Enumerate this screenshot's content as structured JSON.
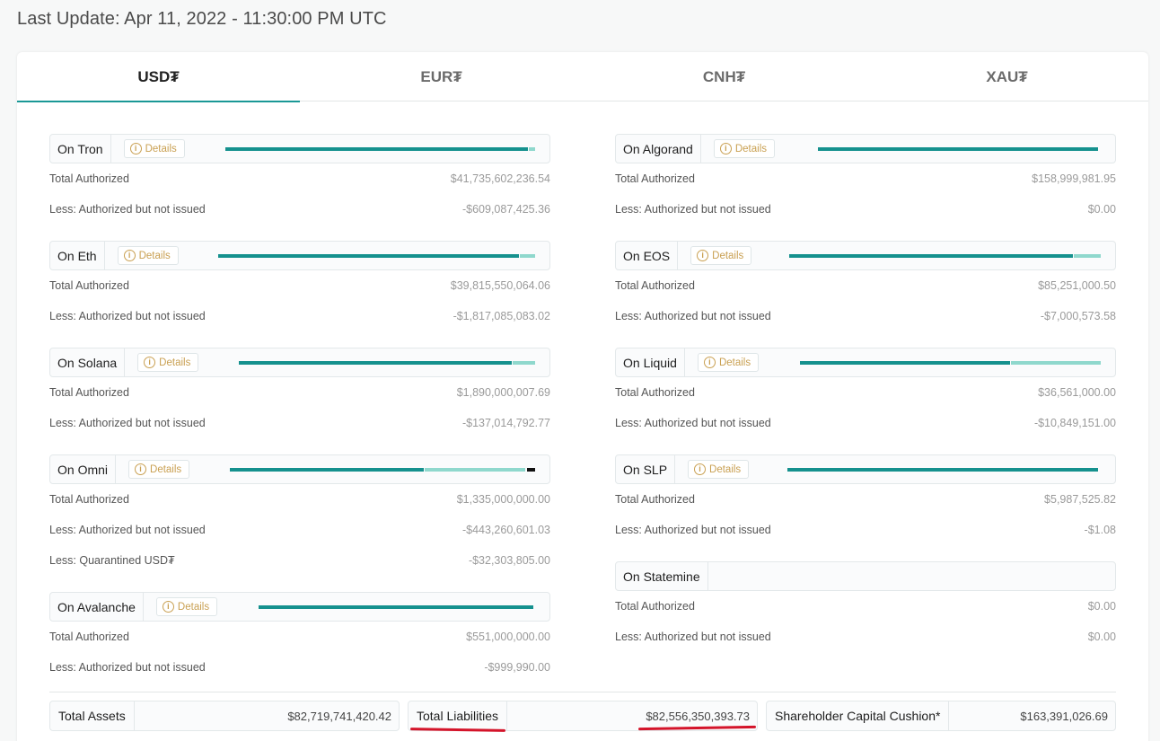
{
  "last_update": "Last Update: Apr 11, 2022 - 11:30:00 PM UTC",
  "tabs": [
    "USD₮",
    "EUR₮",
    "CNH₮",
    "XAU₮"
  ],
  "active_tab": "USD₮",
  "details_label": "Details",
  "accent_color": "#1a9896",
  "left_chains": [
    {
      "name": "On Tron",
      "rows": [
        {
          "label": "Total Authorized",
          "value": "$41,735,602,236.54"
        },
        {
          "label": "Less: Authorized but not issued",
          "value": "-$609,087,425.36"
        }
      ]
    },
    {
      "name": "On Eth",
      "rows": [
        {
          "label": "Total Authorized",
          "value": "$39,815,550,064.06"
        },
        {
          "label": "Less: Authorized but not issued",
          "value": "-$1,817,085,083.02"
        }
      ]
    },
    {
      "name": "On Solana",
      "rows": [
        {
          "label": "Total Authorized",
          "value": "$1,890,000,007.69"
        },
        {
          "label": "Less: Authorized but not issued",
          "value": "-$137,014,792.77"
        }
      ]
    },
    {
      "name": "On Omni",
      "rows": [
        {
          "label": "Total Authorized",
          "value": "$1,335,000,000.00"
        },
        {
          "label": "Less: Authorized but not issued",
          "value": "-$443,260,601.03"
        },
        {
          "label": "Less: Quarantined USD₮",
          "value": "-$32,303,805.00"
        }
      ]
    },
    {
      "name": "On Avalanche",
      "rows": [
        {
          "label": "Total Authorized",
          "value": "$551,000,000.00"
        },
        {
          "label": "Less: Authorized but not issued",
          "value": "-$999,990.00"
        }
      ]
    }
  ],
  "right_chains": [
    {
      "name": "On Algorand",
      "rows": [
        {
          "label": "Total Authorized",
          "value": "$158,999,981.95"
        },
        {
          "label": "Less: Authorized but not issued",
          "value": "$0.00"
        }
      ]
    },
    {
      "name": "On EOS",
      "rows": [
        {
          "label": "Total Authorized",
          "value": "$85,251,000.50"
        },
        {
          "label": "Less: Authorized but not issued",
          "value": "-$7,000,573.58"
        }
      ]
    },
    {
      "name": "On Liquid",
      "rows": [
        {
          "label": "Total Authorized",
          "value": "$36,561,000.00"
        },
        {
          "label": "Less: Authorized but not issued",
          "value": "-$10,849,151.00"
        }
      ]
    },
    {
      "name": "On SLP",
      "rows": [
        {
          "label": "Total Authorized",
          "value": "$5,987,525.82"
        },
        {
          "label": "Less: Authorized but not issued",
          "value": "-$1.08"
        }
      ]
    },
    {
      "name": "On Statemine",
      "rows": [
        {
          "label": "Total Authorized",
          "value": "$0.00"
        },
        {
          "label": "Less: Authorized but not issued",
          "value": "$0.00"
        }
      ]
    }
  ],
  "totals": {
    "assets_label": "Total Assets",
    "assets_value": "$82,719,741,420.42",
    "liabilities_label": "Total Liabilities",
    "liabilities_value": "$82,556,350,393.73",
    "cushion_label": "Shareholder Capital Cushion*",
    "cushion_value": "$163,391,026.69"
  }
}
